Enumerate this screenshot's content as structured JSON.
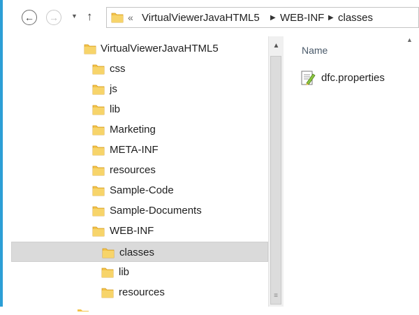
{
  "address": {
    "overflow": "«",
    "crumbs": [
      "VirtualViewerJavaHTML5",
      "WEB-INF",
      "classes"
    ]
  },
  "nav": {
    "back_icon": "back-arrow-icon",
    "forward_icon": "forward-arrow-icon",
    "dropdown_icon": "chevron-down-icon",
    "up_icon": "up-arrow-icon"
  },
  "tree": {
    "items": [
      {
        "label": "VirtualViewerJavaHTML5",
        "level": 0
      },
      {
        "label": "css",
        "level": 1
      },
      {
        "label": "js",
        "level": 1
      },
      {
        "label": "lib",
        "level": 1
      },
      {
        "label": "Marketing",
        "level": 1
      },
      {
        "label": "META-INF",
        "level": 1
      },
      {
        "label": "resources",
        "level": 1
      },
      {
        "label": "Sample-Code",
        "level": 1
      },
      {
        "label": "Sample-Documents",
        "level": 1
      },
      {
        "label": "WEB-INF",
        "level": 1
      },
      {
        "label": "classes",
        "level": 2,
        "selected": true
      },
      {
        "label": "lib",
        "level": 2
      },
      {
        "label": "resources",
        "level": 2
      }
    ]
  },
  "file_list": {
    "column_name": "Name",
    "files": [
      {
        "name": "dfc.properties",
        "icon": "properties-file-icon"
      }
    ]
  },
  "colors": {
    "accent": "#2c9fd6",
    "folder": "#f3c34a",
    "selection": "#dadada"
  }
}
